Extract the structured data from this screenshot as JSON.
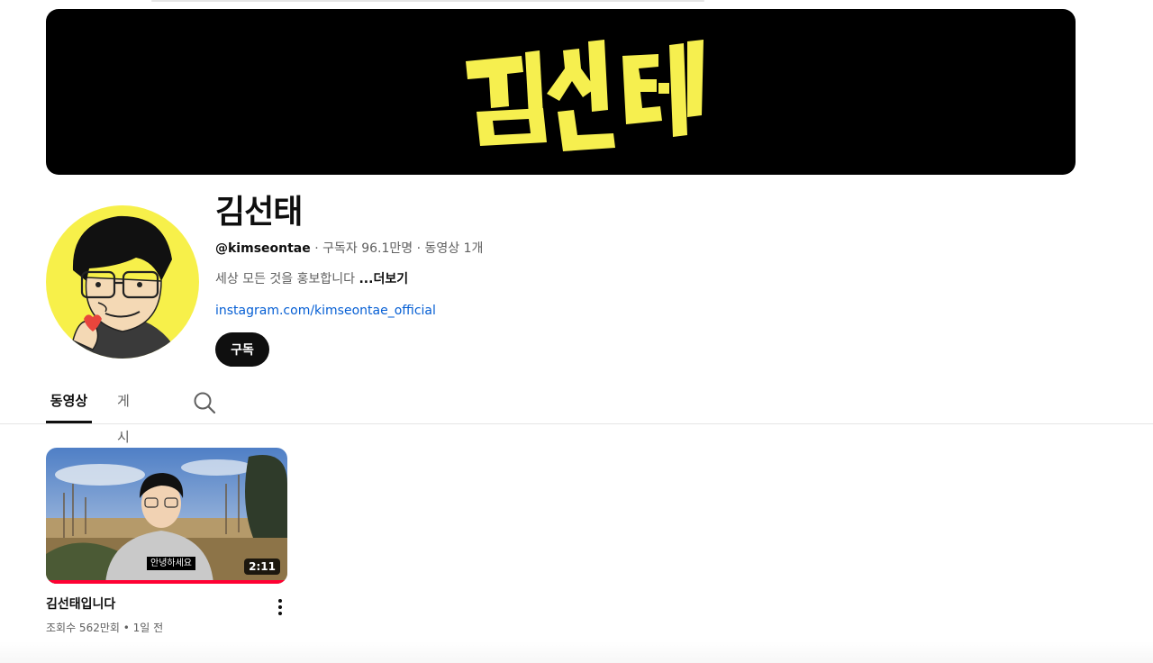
{
  "banner": {
    "logo_text": "김선태",
    "logo_color": "#f6ef4f",
    "background": "#000000"
  },
  "channel": {
    "name": "김선태",
    "handle": "@kimseontae",
    "subscribers": "구독자 96.1만명",
    "video_count": "동영상 1개",
    "separator": " · ",
    "description": "세상 모든 것을 홍보합니다 ",
    "more_label": "...더보기",
    "link": "instagram.com/kimseontae_official",
    "subscribe_label": "구독"
  },
  "tabs": [
    {
      "label": "동영상",
      "active": true
    },
    {
      "label": "게시물",
      "active": false
    }
  ],
  "icons": {
    "search": "search-icon",
    "more": "more-vert-icon"
  },
  "videos": [
    {
      "title": "김선태입니다",
      "caption": "안녕하세요",
      "duration": "2:11",
      "views": "조회수 562만회",
      "age": "1일 전",
      "dot": " • ",
      "watched_fraction": 1.0
    }
  ],
  "colors": {
    "accent": "#ff0033",
    "link": "#065fd4",
    "avatar_bg": "#f7f04a"
  }
}
